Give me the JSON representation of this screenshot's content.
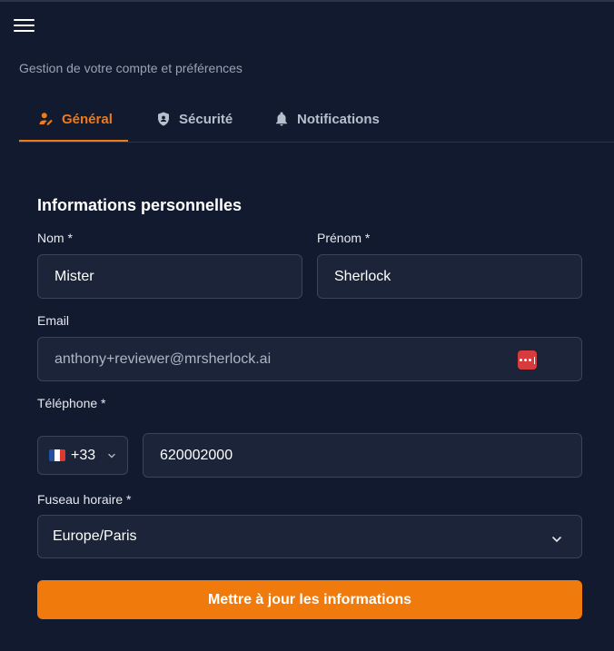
{
  "header": {
    "subtitle": "Gestion de votre compte et préférences"
  },
  "tabs": [
    {
      "label": "Général",
      "icon": "user-edit-icon",
      "active": true
    },
    {
      "label": "Sécurité",
      "icon": "shield-user-icon",
      "active": false
    },
    {
      "label": "Notifications",
      "icon": "bell-icon",
      "active": false
    }
  ],
  "form": {
    "section_title": "Informations personnelles",
    "nom": {
      "label": "Nom *",
      "value": "Mister"
    },
    "prenom": {
      "label": "Prénom *",
      "value": "Sherlock"
    },
    "email": {
      "label": "Email",
      "value": "anthony+reviewer@mrsherlock.ai"
    },
    "telephone": {
      "label": "Téléphone *",
      "country_code": "+33",
      "value": "620002000"
    },
    "timezone": {
      "label": "Fuseau horaire *",
      "value": "Europe/Paris"
    },
    "submit_label": "Mettre à jour les informations"
  },
  "colors": {
    "accent": "#f07a18",
    "background": "#111a2e",
    "field_bg": "#1b2438"
  }
}
